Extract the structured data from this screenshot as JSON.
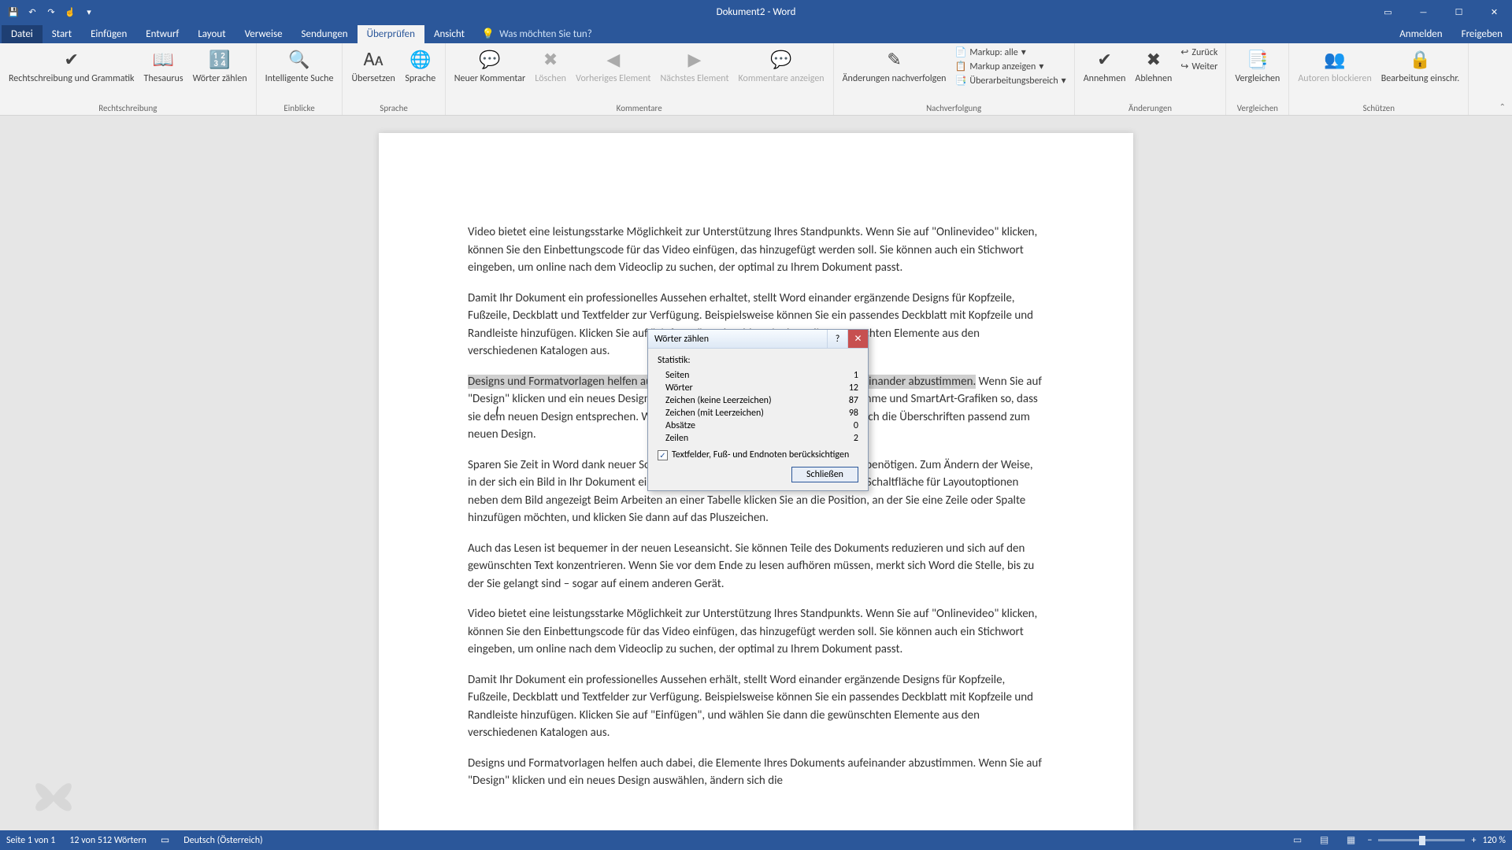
{
  "app": {
    "title": "Dokument2 - Word"
  },
  "qat": {
    "save": "💾",
    "undo": "↶",
    "redo": "↷",
    "touch": "☝",
    "more": "▾"
  },
  "win": {
    "ribbonOpts": "▭",
    "min": "—",
    "max": "☐",
    "close": "✕"
  },
  "tabs": {
    "file": "Datei",
    "home": "Start",
    "insert": "Einfügen",
    "design": "Entwurf",
    "layout": "Layout",
    "references": "Verweise",
    "mailings": "Sendungen",
    "review": "Überprüfen",
    "view": "Ansicht",
    "tellme_icon": "💡",
    "tellme": "Was möchten Sie tun?",
    "signin": "Anmelden",
    "share": "Freigeben"
  },
  "ribbon": {
    "proofing": {
      "spelling": "Rechtschreibung und Grammatik",
      "thesaurus": "Thesaurus",
      "wordcount": "Wörter zählen",
      "label": "Rechtschreibung"
    },
    "insights": {
      "smartlookup": "Intelligente Suche",
      "label": "Einblicke"
    },
    "language": {
      "translate": "Übersetzen",
      "language": "Sprache",
      "label": "Sprache"
    },
    "comments": {
      "new": "Neuer Kommentar",
      "delete": "Löschen",
      "prev": "Vorheriges Element",
      "next": "Nächstes Element",
      "show": "Kommentare anzeigen",
      "label": "Kommentare"
    },
    "tracking": {
      "trackchanges": "Änderungen nachverfolgen",
      "markup_all": "Markup: alle",
      "show_markup": "Markup anzeigen",
      "reviewpane": "Überarbeitungsbereich",
      "label": "Nachverfolgung"
    },
    "changes": {
      "accept": "Annehmen",
      "reject": "Ablehnen",
      "back": "Zurück",
      "next": "Weiter",
      "label": "Änderungen"
    },
    "compare": {
      "compare": "Vergleichen",
      "label": "Vergleichen"
    },
    "protect": {
      "block": "Autoren blockieren",
      "restrict": "Bearbeitung einschr.",
      "label": "Schützen"
    }
  },
  "doc": {
    "p1": "Video bietet eine leistungsstarke Möglichkeit zur Unterstützung Ihres Standpunkts. Wenn Sie auf \"Onlinevideo\" klicken, können Sie den Einbettungscode für das Video einfügen, das hinzugefügt werden soll. Sie können auch ein Stichwort eingeben, um online nach dem Videoclip zu suchen, der optimal zu Ihrem Dokument passt.",
    "p2": "Damit Ihr Dokument ein professionelles Aussehen erhaltet, stellt Word einander ergänzende Designs für Kopfzeile, Fußzeile, Deckblatt und Textfelder zur Verfügung. Beispielsweise können Sie ein passendes Deckblatt mit Kopfzeile und Randleiste hinzufügen. Klicken Sie auf \"Einfügen\", und wählen Sie dann die gewünschten Elemente aus den verschiedenen Katalogen aus.",
    "p3_sel": "Designs und Formatvorlagen helfen auch dabei, die Elemente Ihres Dokuments aufeinander abzustimmen.",
    "p3_rest": " Wenn Sie auf \"Design\" klicken und ein neues Design auswählen, ändern sich die Grafiken, Diagramme und SmartArt-Grafiken so, dass sie dem neuen Design entsprechen. Wenn Sie Formatvorlagen anwenden, ändern sich die Überschriften passend zum neuen Design.",
    "p4": "Sparen Sie Zeit in Word dank neuer Schaltflächen, die angezeigt werden, wo Sie sie benötigen. Zum Ändern der Weise, in der sich ein Bild in Ihr Dokument einfügt, klicken Sie auf das Bild. Dann wird eine Schaltfläche für Layoutoptionen neben dem Bild angezeigt Beim Arbeiten an einer Tabelle klicken Sie an die Position, an der Sie eine Zeile oder Spalte hinzufügen möchten, und klicken Sie dann auf das Pluszeichen.",
    "p5": "Auch das Lesen ist bequemer in der neuen Leseansicht. Sie können Teile des Dokuments reduzieren und sich auf den gewünschten Text konzentrieren. Wenn Sie vor dem Ende zu lesen aufhören müssen, merkt sich Word die Stelle, bis zu der Sie gelangt sind – sogar auf einem anderen Gerät.",
    "p6": "Video bietet eine leistungsstarke Möglichkeit zur Unterstützung Ihres Standpunkts. Wenn Sie auf \"Onlinevideo\" klicken, können Sie den Einbettungscode für das Video einfügen, das hinzugefügt werden soll. Sie können auch ein Stichwort eingeben, um online nach dem Videoclip zu suchen, der optimal zu Ihrem Dokument passt.",
    "p7": "Damit Ihr Dokument ein professionelles Aussehen erhält, stellt Word einander ergänzende Designs für Kopfzeile, Fußzeile, Deckblatt und Textfelder zur Verfügung. Beispielsweise können Sie ein passendes Deckblatt mit Kopfzeile und Randleiste hinzufügen. Klicken Sie auf \"Einfügen\", und wählen Sie dann die gewünschten Elemente aus den verschiedenen Katalogen aus.",
    "p8": "Designs und Formatvorlagen helfen auch dabei, die Elemente Ihres Dokuments aufeinander abzustimmen. Wenn Sie auf \"Design\" klicken und ein neues Design auswählen, ändern sich die"
  },
  "dialog": {
    "title": "Wörter zählen",
    "stat_label": "Statistik:",
    "rows": [
      {
        "k": "Seiten",
        "v": "1"
      },
      {
        "k": "Wörter",
        "v": "12"
      },
      {
        "k": "Zeichen (keine Leerzeichen)",
        "v": "87"
      },
      {
        "k": "Zeichen (mit Leerzeichen)",
        "v": "98"
      },
      {
        "k": "Absätze",
        "v": "0"
      },
      {
        "k": "Zeilen",
        "v": "2"
      }
    ],
    "checkbox": "Textfelder, Fuß- und Endnoten berücksichtigen",
    "check_mark": "✓",
    "close_btn": "Schließen",
    "help": "?",
    "x": "✕"
  },
  "status": {
    "page": "Seite 1 von 1",
    "words": "12 von 512 Wörtern",
    "lang_icon": "▭",
    "language": "Deutsch (Österreich)",
    "zoom": "120 %",
    "minus": "−",
    "plus": "+"
  }
}
